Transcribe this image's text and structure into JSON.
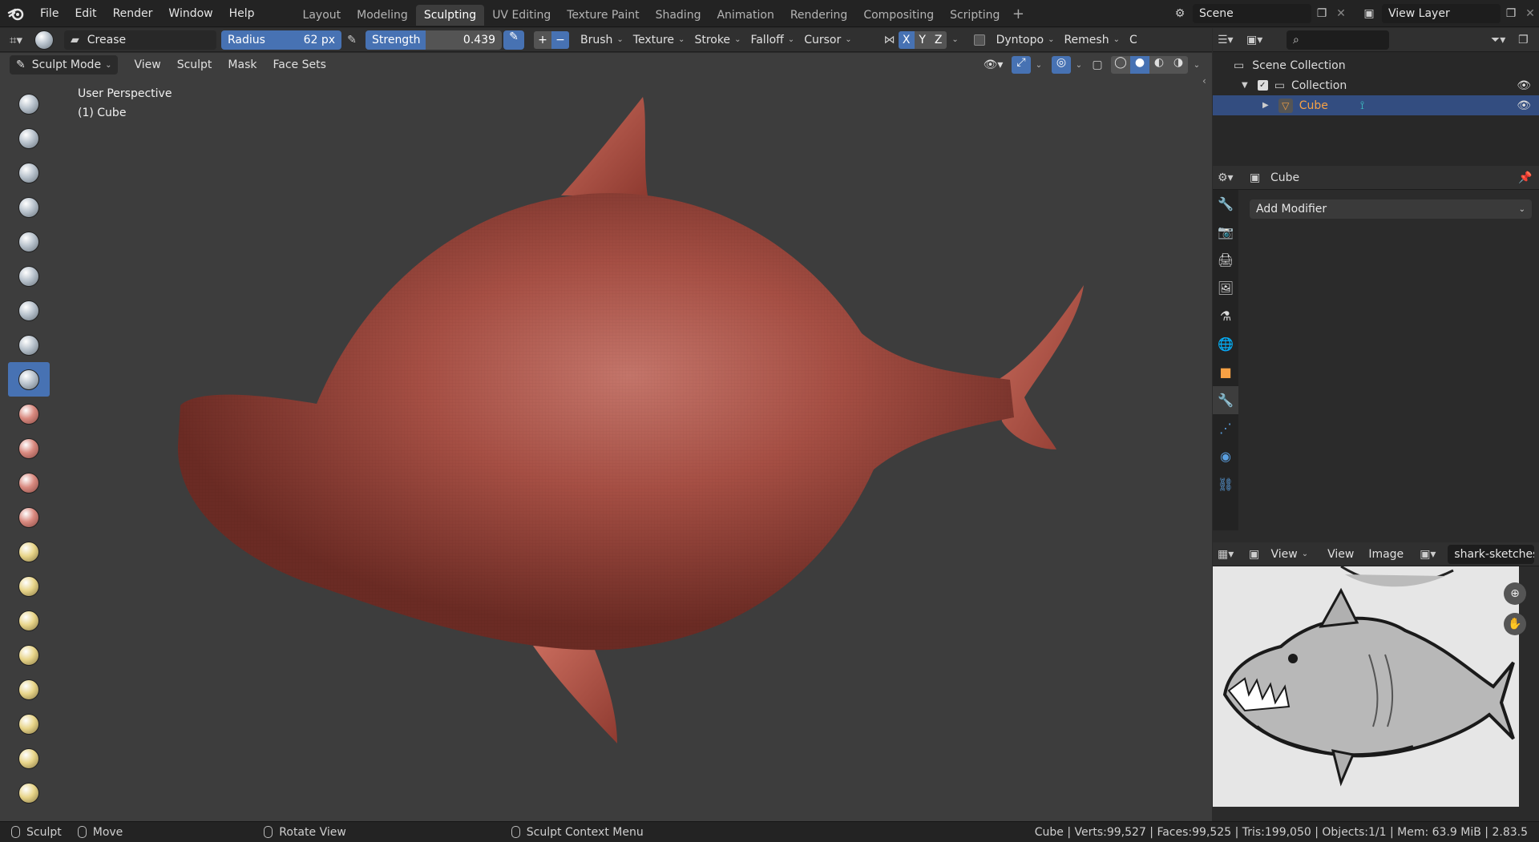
{
  "menu": {
    "file": "File",
    "edit": "Edit",
    "render": "Render",
    "window": "Window",
    "help": "Help"
  },
  "workspaces": [
    "Layout",
    "Modeling",
    "Sculpting",
    "UV Editing",
    "Texture Paint",
    "Shading",
    "Animation",
    "Rendering",
    "Compositing",
    "Scripting"
  ],
  "active_workspace": "Sculpting",
  "scene": {
    "name": "Scene",
    "view_layer": "View Layer"
  },
  "tool_header": {
    "brush_name": "Crease",
    "radius_label": "Radius",
    "radius_value": "62 px",
    "radius_fraction": 0.0,
    "strength_label": "Strength",
    "strength_value": "0.439",
    "strength_fraction": 0.439,
    "brush": "Brush",
    "texture": "Texture",
    "stroke": "Stroke",
    "falloff": "Falloff",
    "cursor": "Cursor",
    "axis_x": "X",
    "axis_y": "Y",
    "axis_z": "Z",
    "dyntopo": "Dyntopo",
    "remesh": "Remesh",
    "cut_off": "C"
  },
  "mode_header": {
    "mode": "Sculpt Mode",
    "view": "View",
    "sculpt": "Sculpt",
    "mask": "Mask",
    "face_sets": "Face Sets"
  },
  "viewport": {
    "perspective": "User Perspective",
    "object": "(1) Cube"
  },
  "outliner": {
    "scene_collection": "Scene Collection",
    "collection": "Collection",
    "cube": "Cube"
  },
  "properties": {
    "object": "Cube",
    "add_modifier": "Add Modifier"
  },
  "image_editor": {
    "view_menu": "View",
    "view": "View",
    "image": "Image",
    "image_name": "shark-sketches"
  },
  "status": {
    "sculpt": "Sculpt",
    "move": "Move",
    "rotate": "Rotate View",
    "context": "Sculpt Context Menu",
    "stats": "Cube | Verts:99,527 | Faces:99,525 | Tris:199,050 | Objects:1/1 | Mem: 63.9 MiB | 2.83.5"
  },
  "colors": {
    "accent": "#4772b3",
    "selection": "#334d80",
    "mesh": "#b45a4e",
    "active_object": "#f7a144"
  }
}
